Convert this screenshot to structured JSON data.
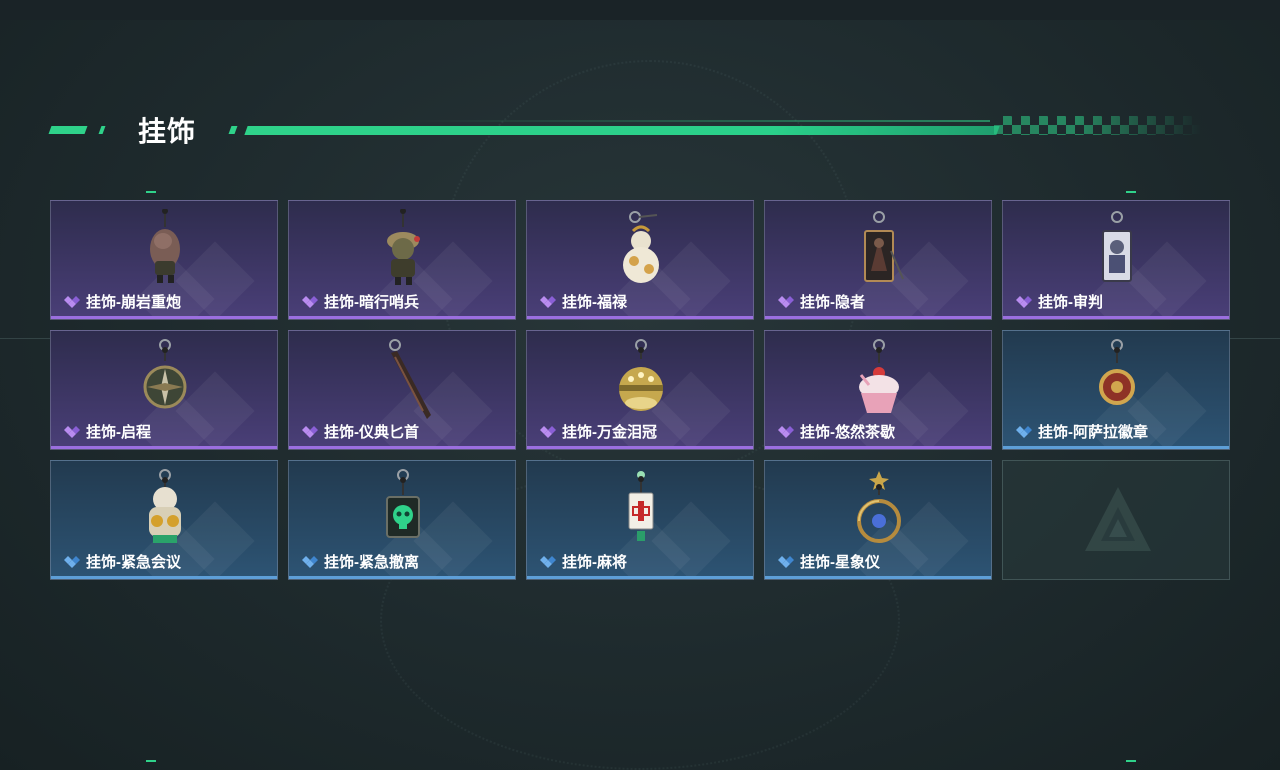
{
  "section": {
    "title": "挂饰"
  },
  "colors": {
    "accent": "#2fd28a",
    "purple_rarity": "#9b6fe0",
    "blue_rarity": "#5e9fd8"
  },
  "items": [
    {
      "label": "挂饰-崩岩重炮",
      "rarity": "purple",
      "icon": "grenade-figure-charm-icon"
    },
    {
      "label": "挂饰-暗行哨兵",
      "rarity": "purple",
      "icon": "soldier-figure-charm-icon"
    },
    {
      "label": "挂饰-福禄",
      "rarity": "purple",
      "icon": "gourd-charm-icon"
    },
    {
      "label": "挂饰-隐者",
      "rarity": "purple",
      "icon": "tarot-card-hermit-icon"
    },
    {
      "label": "挂饰-审判",
      "rarity": "purple",
      "icon": "tarot-card-judgement-icon"
    },
    {
      "label": "挂饰-启程",
      "rarity": "purple",
      "icon": "compass-medallion-icon"
    },
    {
      "label": "挂饰-仪典匕首",
      "rarity": "purple",
      "icon": "dagger-charm-icon"
    },
    {
      "label": "挂饰-万金泪冠",
      "rarity": "purple",
      "icon": "crown-egg-charm-icon"
    },
    {
      "label": "挂饰-悠然茶歇",
      "rarity": "purple",
      "icon": "cupcake-charm-icon"
    },
    {
      "label": "挂饰-阿萨拉徽章",
      "rarity": "blue",
      "icon": "badge-charm-icon"
    },
    {
      "label": "挂饰-紧急会议",
      "rarity": "blue",
      "icon": "mascot-charm-icon"
    },
    {
      "label": "挂饰-紧急撤离",
      "rarity": "blue",
      "icon": "skull-box-charm-icon"
    },
    {
      "label": "挂饰-麻将",
      "rarity": "blue",
      "icon": "mahjong-tile-charm-icon"
    },
    {
      "label": "挂饰-星象仪",
      "rarity": "blue",
      "icon": "astrolabe-charm-icon"
    }
  ],
  "empty_slot": {
    "icon": "game-logo-icon"
  }
}
